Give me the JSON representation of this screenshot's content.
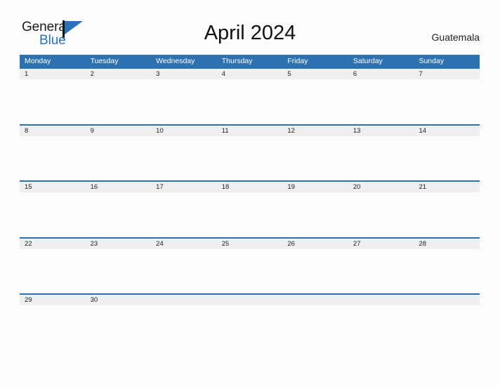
{
  "header": {
    "logo": {
      "word_one": "General",
      "word_two": "Blue",
      "mark": "flag-triangle-icon",
      "accent_color": "#2a73b8"
    },
    "title": "April 2024",
    "locale": "Guatemala"
  },
  "calendar": {
    "header_color": "#2e71b0",
    "date_band_color": "#efefef",
    "weekdays": [
      "Monday",
      "Tuesday",
      "Wednesday",
      "Thursday",
      "Friday",
      "Saturday",
      "Sunday"
    ],
    "weeks": [
      {
        "days": [
          "1",
          "2",
          "3",
          "4",
          "5",
          "6",
          "7"
        ]
      },
      {
        "days": [
          "8",
          "9",
          "10",
          "11",
          "12",
          "13",
          "14"
        ]
      },
      {
        "days": [
          "15",
          "16",
          "17",
          "18",
          "19",
          "20",
          "21"
        ]
      },
      {
        "days": [
          "22",
          "23",
          "24",
          "25",
          "26",
          "27",
          "28"
        ]
      },
      {
        "days": [
          "29",
          "30",
          "",
          "",
          "",
          "",
          ""
        ]
      }
    ]
  }
}
